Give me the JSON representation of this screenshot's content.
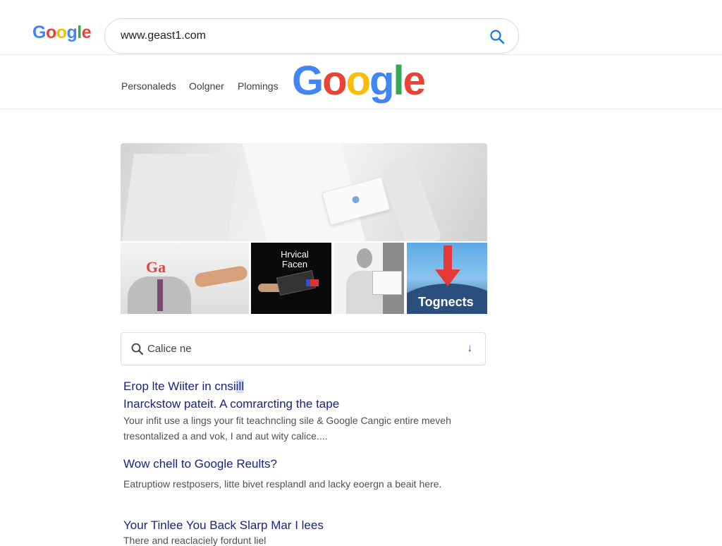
{
  "header": {
    "logo_letters": [
      "G",
      "o",
      "o",
      "g",
      "l",
      "e"
    ],
    "search_url": "www.geast1.com"
  },
  "nav": {
    "links": [
      "Personaleds",
      "Oolgner",
      "Plomings"
    ],
    "logo_letters": [
      "G",
      "o",
      "o",
      "g",
      "l",
      "e"
    ]
  },
  "images": {
    "thumb1_logo": "Ga",
    "thumb2_caption_line1": "Hrvical",
    "thumb2_caption_line2": "Facen",
    "thumb4_caption": "Tognects"
  },
  "query_box": {
    "text": "Calice ne",
    "arrow": "↓"
  },
  "results": [
    {
      "title_line1_pre": "Erop lte Wiiter in cnsi",
      "title_line1_hl": "ill",
      "title_line2": "Inarckstow pateit. A comrarcting the tape",
      "snippet_line1": "Your infit use a lings your fit teachncling sile & Google Cangic entire meveh",
      "snippet_line2": "tresontalized a and vok, I and aut wity calice...."
    },
    {
      "title": "Wow chell to Google Reults?",
      "snippet": "Eatruptiow restposers, litte bivet resplandl and lacky eoergn a beait here."
    },
    {
      "title": "Your Tinlee You Back Slarp Mar I lees",
      "snippet": "There and reaclaciely fordunt liel"
    }
  ],
  "colors": {
    "google_blue": "#4285f4",
    "google_red": "#ea4335",
    "google_yellow": "#fbbc05",
    "google_green": "#34a853",
    "link": "#1a237e",
    "highlight": "#cfe0f7"
  },
  "icons": [
    "search-icon",
    "magnifier-icon",
    "arrow-down-icon"
  ]
}
